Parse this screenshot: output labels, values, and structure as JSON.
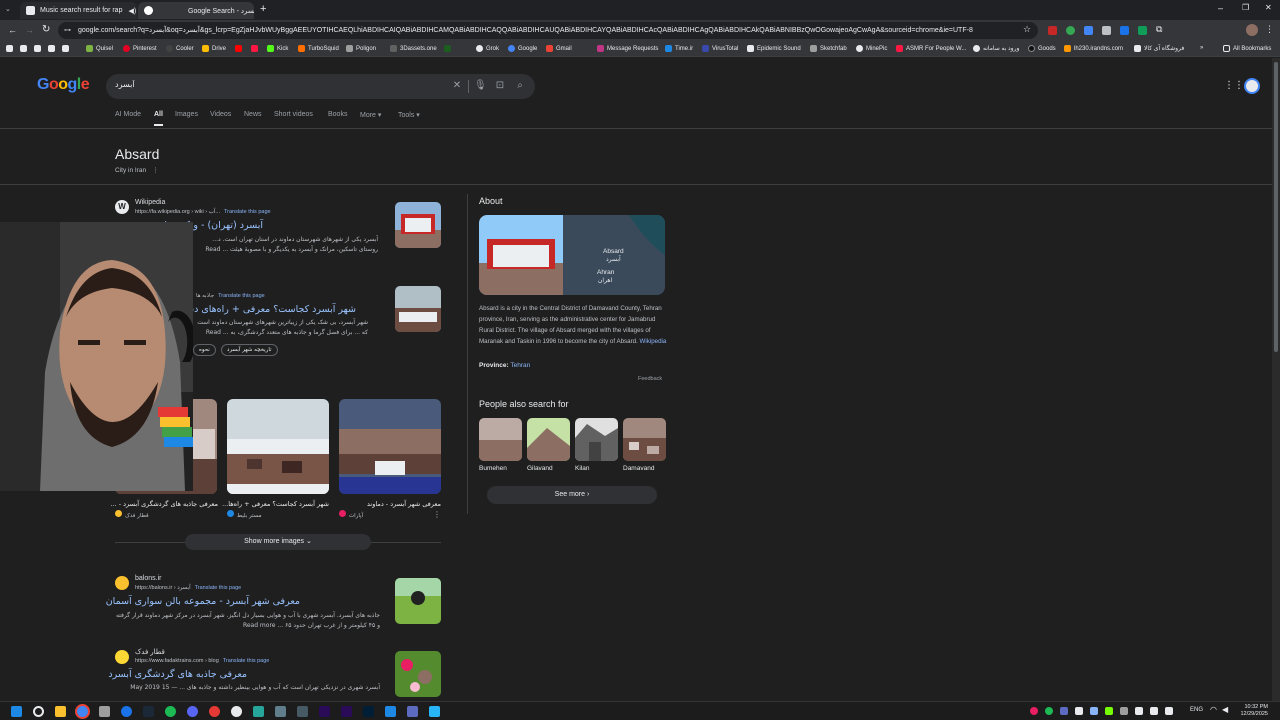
{
  "browser": {
    "tabs": [
      {
        "title": "Music search result for rap",
        "active": false
      },
      {
        "title": "Google Search - آبسرد",
        "active": true
      }
    ],
    "address": "google.com/search?q=آبسرد&oq=آبسرد&gs_lcrp=EgZjaHJvbWUyBggAEEUYOTIHCAEQLhiABDIHCAIQABiABDIHCAMQABiABDIHCAQQABiABDIHCAUQABiABDIHCAYQABiABDIHCAcQABiABDIHCAgQABiABDIHCAkQABiABNIBBzQwOGowajeoAgCwAgA&sourceid=chrome&ie=UTF-8",
    "bookmarks": [
      "Quisel",
      "Pinterest",
      "Cooler",
      "Drive",
      "Kick",
      "TurboSquid",
      "Poligon",
      "3Dassets.one",
      "Grok",
      "Google",
      "Gmail",
      "Message Requests",
      "Time.ir",
      "VirusTotal",
      "Epidemic Sound",
      "Sketchfab",
      "MinePic",
      "ASMR For People W...",
      "ورود به سامانه",
      "Goods",
      "lh230.irandns.com",
      "فروشگاه آی کالا",
      "All Bookmarks"
    ]
  },
  "google": {
    "logo": "Google",
    "query": "آبسرد",
    "nav_tabs": [
      "AI Mode",
      "All",
      "Images",
      "Videos",
      "News",
      "Short videos",
      "Books",
      "More ▾",
      "Tools ▾"
    ],
    "entity_title": "Absard",
    "entity_subtitle": "City in Iran",
    "results": [
      {
        "site": "Wikipedia",
        "url": "https://fa.wikipedia.org › wiki › آب...",
        "translate": "Translate this page",
        "title": "آبسرد (تهران) - ویکی‌پدیا",
        "snippet": "آبسرد یکی از شهرهای شهرستان دماوند در استان تهران است. د... روستای تاسکین، مرانک و آبسرد به یکدیگر و با مصوبهٔ هیئت ... Read"
      },
      {
        "site": "جاذبه ها",
        "url": "...",
        "translate": "Translate this page",
        "title": "شهر آبسرد کجاست؟ معرفی + راه‌های دسترسی",
        "snippet": "شهر آبسرد، بی شک یکی از زیباترین شهرهای شهرستان دماوند است که ... برای فصل گرما و جاذبه های متعدد گردشگری، به ... Read more",
        "chips": [
          "تاریخچه شهر آبسرد",
          "نحوه"
        ]
      },
      {
        "site": "balons.ir",
        "url": "https://balons.ir › آبسرد",
        "translate": "Translate this page",
        "title": "معرفی شهر آبسرد - مجموعه بالن سواری آسمان",
        "snippet": "جاذبه های آبسرد. آبسرد شهری با آب و هوایی بسیار دل انگیز. شهر آبسرد در مرکز شهر دماوند قرار گرفته و ۴۵ کیلومتر و از غرب تهران حدود ۶۵ ... Read more"
      },
      {
        "site": "قطار فدک",
        "url": "https://www.fadaktrains.com › blog",
        "translate": "Translate this page",
        "title": "معرفی جاذبه های گردشگری آبسرد",
        "date": "15 May 2019",
        "snippet": "آبسرد شهری در نزدیکی تهران است که آب و هوایی بینظیر داشته و جاذبه های ..."
      }
    ],
    "images": [
      {
        "caption": "معرفی جاذبه های گردشگری آبسرد - ...",
        "source": "قطار فدک"
      },
      {
        "caption": "شهر آبسرد کجاست؟ معرفی + راه‌ها...",
        "source": "مستر بلیط"
      },
      {
        "caption": "معرفی شهر آبسرد - دماوند",
        "source": "آپارات"
      }
    ],
    "show_more_images": "Show more images",
    "about": {
      "heading": "About",
      "map_label_en": "Absard",
      "map_label_fa": "آبسرد",
      "map_label2_en": "Ahran",
      "map_label2_fa": "اهران",
      "description": "Absard is a city in the Central District of Damavand County, Tehran province, Iran, serving as the administrative center for Jamabrud Rural District. The village of Absard merged with the villages of Maranak and Taskin in 1996 to become the city of Absard.",
      "description_link": "Wikipedia",
      "province_label": "Province:",
      "province_value": "Tehran",
      "feedback": "Feedback",
      "pas_heading": "People also search for",
      "pas": [
        "Bumehen",
        "Gilavand",
        "Kilan",
        "Damavand"
      ],
      "see_more": "See more"
    }
  },
  "taskbar": {
    "language": "ENG",
    "time": "10:32 PM",
    "date": "12/29/2025"
  },
  "colors": {
    "page_bg": "#1f1f1f",
    "link": "#99c3ff",
    "accent": "#8ab4f8"
  }
}
